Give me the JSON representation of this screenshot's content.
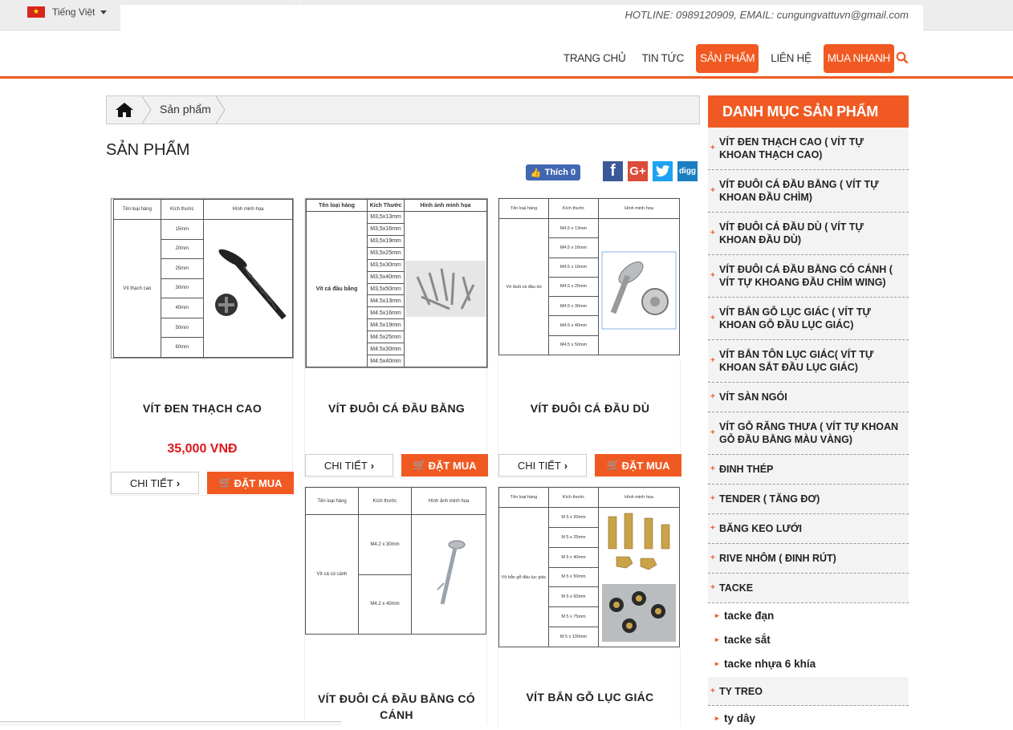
{
  "topbar": {
    "language": "Tiếng Việt",
    "hotline": "HOTLINE: 0989120909, EMAIL: cungungvattuvn@gmail.com"
  },
  "menu": {
    "items": [
      "TRANG CHỦ",
      "TIN TỨC",
      "SẢN PHẨM",
      "LIÊN HỆ",
      "MUA NHANH"
    ]
  },
  "breadcrumb": {
    "current": "Sản phẩm"
  },
  "page_title": "SẢN PHẨM",
  "social": {
    "like": "Thích 0",
    "facebook": "f",
    "google": "G+",
    "digg": "digg"
  },
  "products": [
    {
      "name": "VÍT ĐEN THẠCH CAO",
      "price": "35,000 VNĐ",
      "detail": "CHI TIẾT",
      "buy": "ĐẶT MUA"
    },
    {
      "name": "VÍT ĐUÔI CÁ ĐẦU BẰNG",
      "detail": "CHI TIẾT",
      "buy": "ĐẶT MUA"
    },
    {
      "name": "VÍT ĐUÔI CÁ ĐẦU DÙ",
      "detail": "CHI TIẾT",
      "buy": "ĐẶT MUA"
    },
    {
      "name": "VÍT ĐUÔI CÁ ĐẦU BẰNG CÓ CÁNH"
    },
    {
      "name": "VÍT BẮN GỖ LỤC GIÁC"
    }
  ],
  "tables": {
    "t1": {
      "h1": "Tên loại hàng",
      "h2": "Kích thước",
      "h3": "Hình minh họa",
      "row": "Vít thạch cao",
      "sizes": [
        "15mm",
        "20mm",
        "25mm",
        "30mm",
        "40mm",
        "50mm",
        "60mm"
      ]
    },
    "t2": {
      "h1": "Tên  loại hàng",
      "h2": "Kích Thước",
      "h3": "Hình ảnh minh họa",
      "row": "Vít cá đầu bằng",
      "sizes": [
        "M3,5x13mm",
        "M3,5x16mm",
        "M3,5x19mm",
        "M3,5x25mm",
        "M3,5x30mm",
        "M3,5x40mm",
        "M3,5x50mm",
        "M4.5x13mm",
        "M4.5x16mm",
        "M4.5x19mm",
        "M4.5x25mm",
        "M4.5x30mm",
        "M4.5x40mm"
      ]
    },
    "t3": {
      "h1": "Tên loại hàng",
      "h2": "Kích thước",
      "h3": "Hình minh họa",
      "row": "Vít đuôi cá đầu dù",
      "sizes": [
        "M4.5 x 13mm",
        "M4.5 x 16mm",
        "M4.5 x 19mm",
        "M4.5 x 25mm",
        "M4.5 x 30mm",
        "M4.5 x 40mm",
        "M4.5 x 50mm"
      ]
    },
    "t4": {
      "h1": "Tên loại hàng",
      "h2": "Kích thước",
      "h3": "Hình ảnh minh họa",
      "row": "Vít cá có cánh",
      "sizes": [
        "M4.2 x 30mm",
        "M4.2 x 40mm"
      ]
    },
    "t5": {
      "h1": "Tên loại hàng",
      "h2": "Kích thước",
      "h3": "Hình minh họa",
      "row": "Vít bắn gỗ đầu lục giác",
      "sizes": [
        "M 5 x 20mm",
        "M 5 x 25mm",
        "M 5 x 40mm",
        "M 5 x 50mm",
        "M 5 x 60mm",
        "M 5 x 75mm",
        "M 5 x 100mm"
      ]
    }
  },
  "sidebar": {
    "title": "DANH MỤC SẢN PHẨM",
    "items": [
      "VÍT ĐEN THẠCH CAO ( VÍT TỰ KHOAN THẠCH CAO)",
      "VÍT ĐUÔI CÁ ĐẦU BẰNG ( VÍT TỰ KHOAN ĐẦU CHÌM)",
      "VÍT ĐUÔI CÁ ĐẦU DÙ ( VÍT TỰ KHOAN ĐẦU DÙ)",
      "VÍT ĐUÔI CÁ ĐẦU BẰNG CÓ CÁNH ( VÍT TỰ KHOANG ĐẦU CHÌM WING)",
      "VÍT BẮN GỖ LỤC GIÁC ( VÍT TỰ KHOAN GỖ ĐẦU LỤC GIÁC)",
      "VÍT BẮN TÔN LỤC GIÁC( VÍT TỰ KHOAN SẮT ĐẦU LỤC GIÁC)",
      "VÍT SÀN NGÓI",
      "VÍT GỖ RĂNG THƯA ( VÍT TỰ KHOAN GỖ ĐẦU BẰNG MÀU VÀNG)",
      "ĐINH THÉP",
      "TENDER ( TĂNG ĐƠ)",
      "BĂNG KEO LƯỚI",
      "RIVE NHÔM ( ĐINH RÚT)",
      "TACKE"
    ],
    "subitems": [
      "tacke đạn",
      "tacke sắt",
      "tacke nhựa 6 khía"
    ],
    "item_ty_treo": "TY TREO",
    "sub_ty_day": "ty dây"
  },
  "colors": {
    "accent": "#f05a22",
    "price": "#e0171a"
  }
}
